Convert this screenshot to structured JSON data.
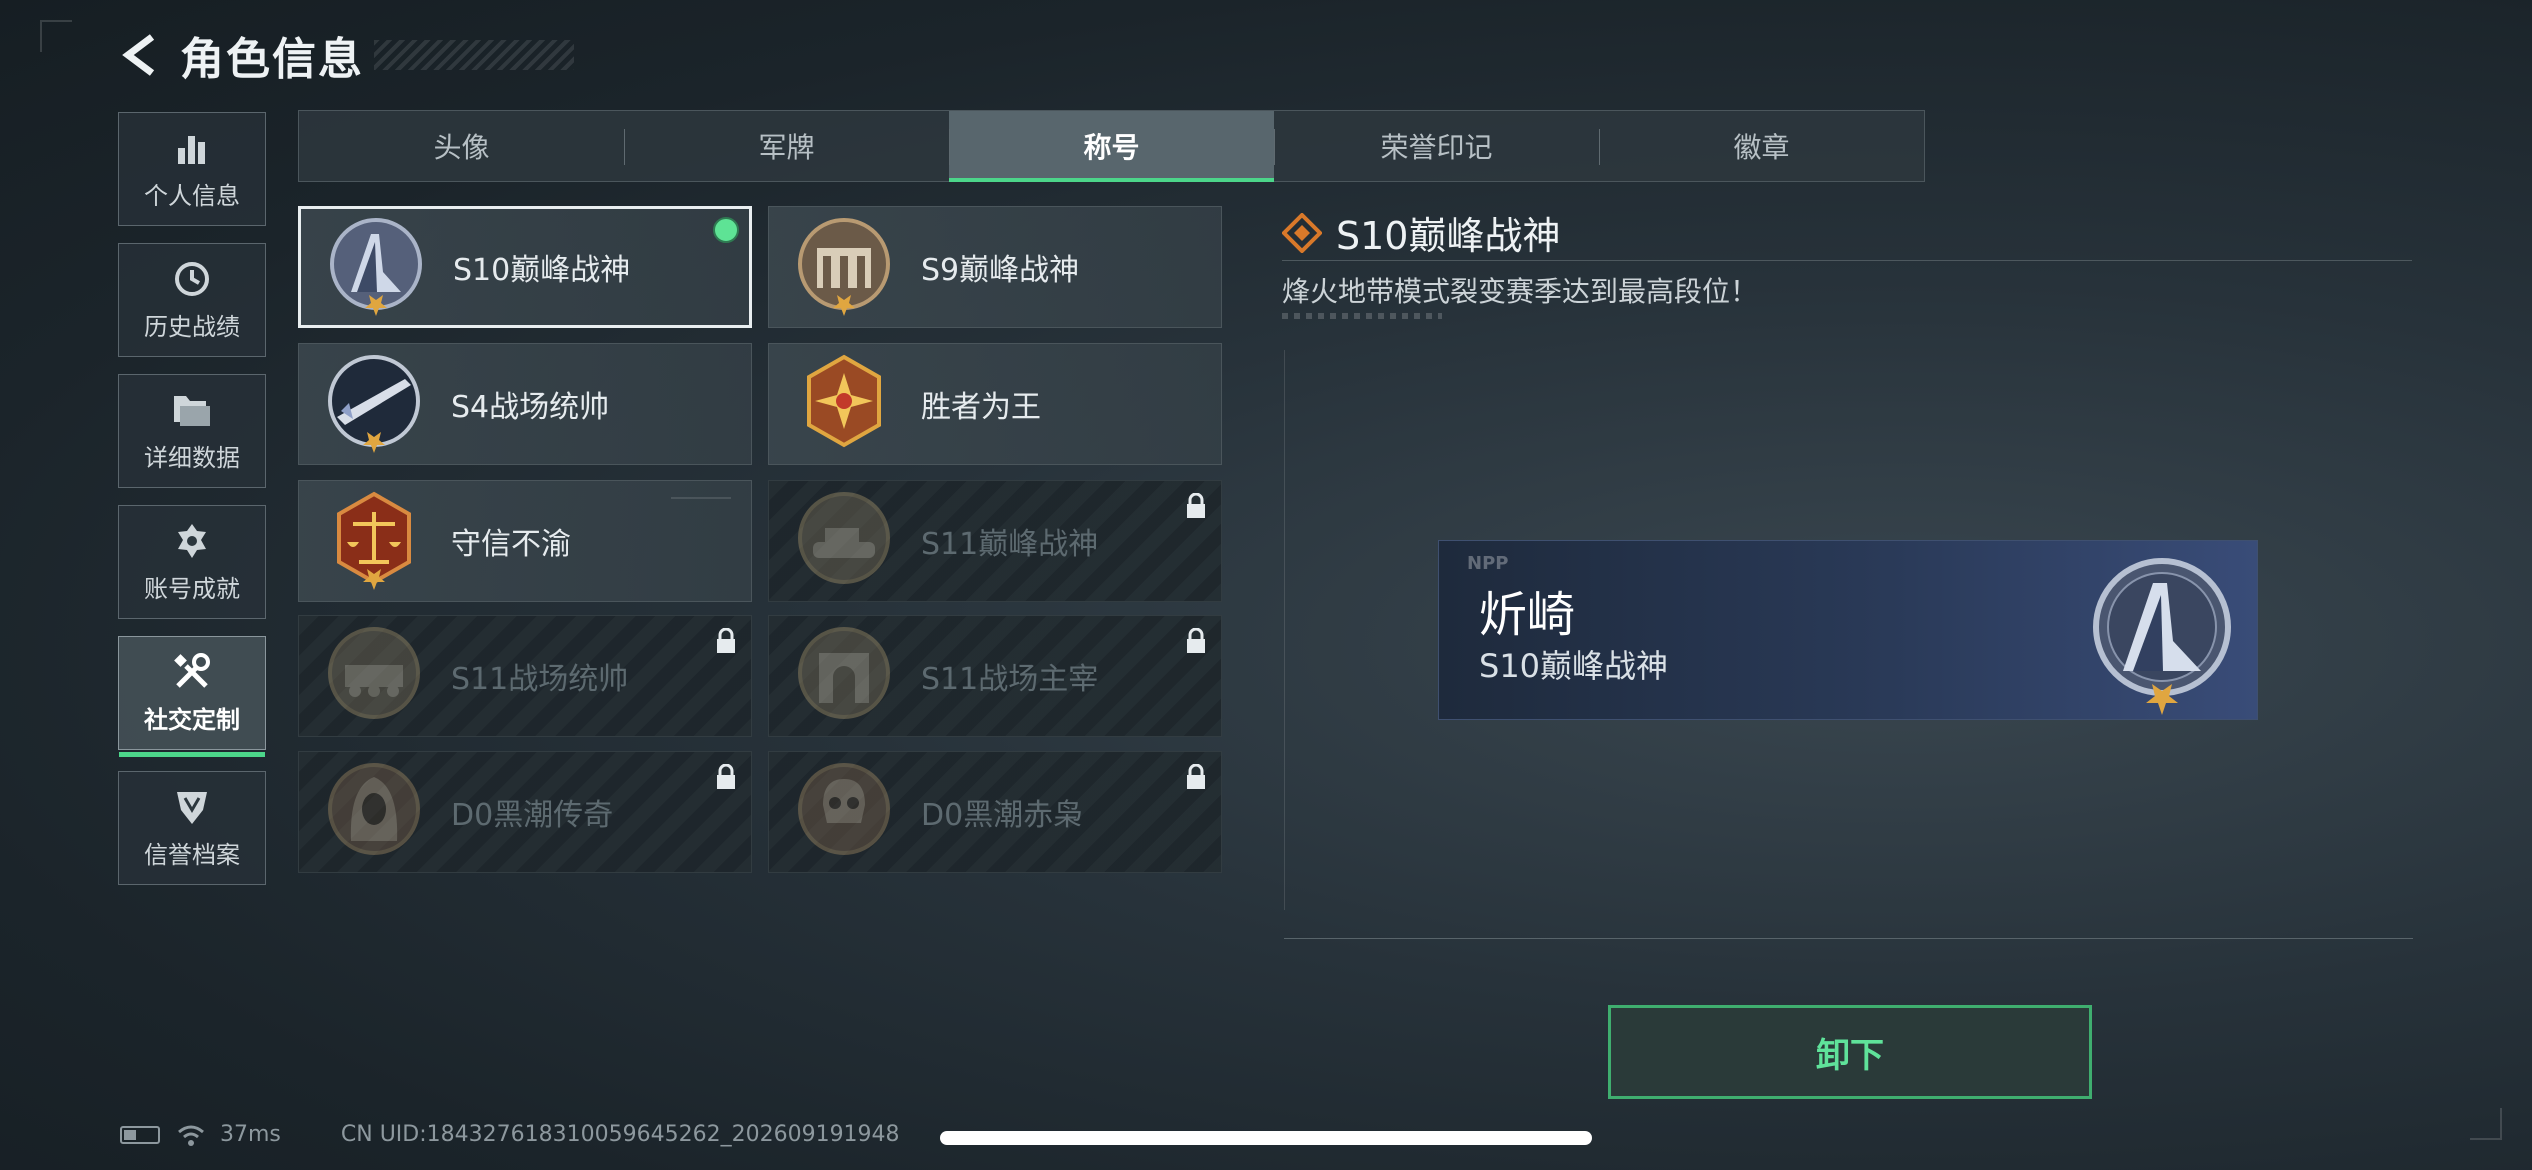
{
  "header": {
    "title": "角色信息"
  },
  "nav": [
    {
      "label": "个人信息",
      "icon": "bar-chart-icon"
    },
    {
      "label": "历史战绩",
      "icon": "clock-history-icon"
    },
    {
      "label": "详细数据",
      "icon": "folder-icon"
    },
    {
      "label": "账号成就",
      "icon": "achievement-icon"
    },
    {
      "label": "社交定制",
      "icon": "tools-icon",
      "active": true
    },
    {
      "label": "信誉档案",
      "icon": "credit-shield-icon"
    }
  ],
  "tabs": [
    {
      "label": "头像"
    },
    {
      "label": "军牌"
    },
    {
      "label": "称号",
      "active": true
    },
    {
      "label": "荣誉印记"
    },
    {
      "label": "徽章"
    }
  ],
  "titles": [
    {
      "name": "S10巅峰战神",
      "locked": false,
      "selected": true,
      "equipped": true,
      "medal": "tower-medal"
    },
    {
      "name": "S9巅峰战神",
      "locked": false,
      "medal": "gate-medal"
    },
    {
      "name": "S4战场统帅",
      "locked": false,
      "medal": "missile-medal"
    },
    {
      "name": "胜者为王",
      "locked": false,
      "medal": "star-cross-medal"
    },
    {
      "name": "守信不渝",
      "locked": false,
      "medal": "scales-medal"
    },
    {
      "name": "S11巅峰战神",
      "locked": true,
      "medal": "tank-medal"
    },
    {
      "name": "S11战场统帅",
      "locked": true,
      "medal": "vehicle-medal"
    },
    {
      "name": "S11战场主宰",
      "locked": true,
      "medal": "arch-medal"
    },
    {
      "name": "D0黑潮传奇",
      "locked": true,
      "medal": "hood-medal"
    },
    {
      "name": "D0黑潮赤枭",
      "locked": true,
      "medal": "skull-medal"
    }
  ],
  "detail": {
    "title": "S10巅峰战神",
    "description": "烽火地带模式裂变赛季达到最高段位！",
    "preview": {
      "npp": "NPP",
      "player_name": "炘崎",
      "player_title": "S10巅峰战神"
    },
    "unequip_label": "卸下"
  },
  "status": {
    "ping": "37ms",
    "uid": "CN UID:18432761831005964526​2_202609191948"
  },
  "colors": {
    "accent_green": "#4cd68a",
    "medal_gold": "#e0a640"
  }
}
